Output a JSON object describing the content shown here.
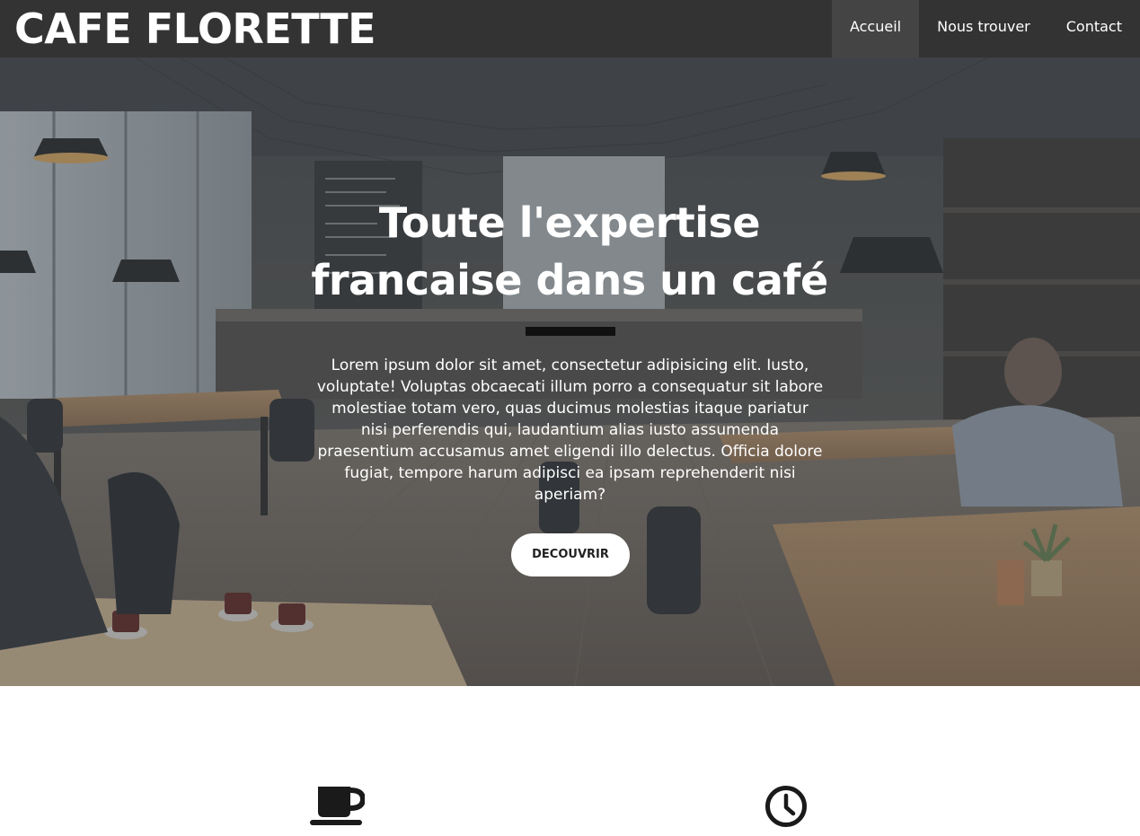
{
  "brand": {
    "name": "CAFE FLORETTE"
  },
  "nav": {
    "items": [
      {
        "label": "Accueil",
        "active": true
      },
      {
        "label": "Nous trouver",
        "active": false
      },
      {
        "label": "Contact",
        "active": false
      }
    ]
  },
  "hero": {
    "title": "Toute l'expertise francaise dans un café",
    "text": "Lorem ipsum dolor sit amet, consectetur adipisicing elit. Iusto, voluptate! Voluptas obcaecati illum porro a consequatur sit labore molestiae totam vero, quas ducimus molestias itaque pariatur nisi perferendis qui, laudantium alias iusto assumenda praesentium accusamus amet eligendi illo delectus. Officia dolore fugiat, tempore harum adipisci ea ipsam reprehenderit nisi aperiam?",
    "button_label": "DECOUVRIR"
  },
  "features": {
    "icons": [
      "coffee-cup-icon",
      "clock-icon"
    ]
  },
  "colors": {
    "navbar": "#333333",
    "nav_active": "#444444",
    "divider": "#111111",
    "button_bg": "#ffffff"
  }
}
